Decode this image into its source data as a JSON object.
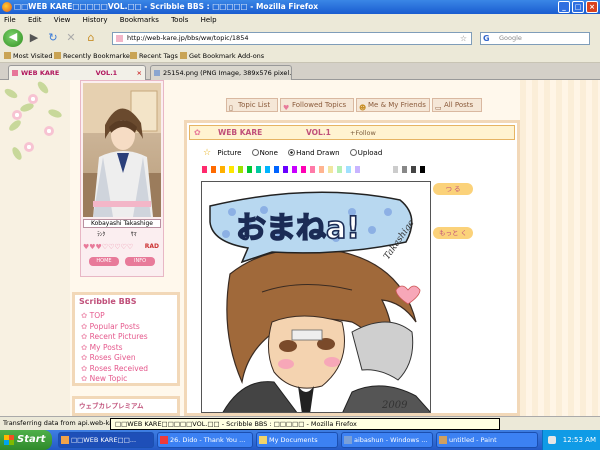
{
  "window": {
    "title": "□□WEB KARE□□□□□VOL.□□ - Scribble BBS : □□□□□ - Mozilla Firefox"
  },
  "menu": [
    "File",
    "Edit",
    "View",
    "History",
    "Bookmarks",
    "Tools",
    "Help"
  ],
  "nav": {
    "url": "http://web-kare.jp/bbs/ww/topic/1854",
    "search_placeholder": "Google"
  },
  "bookmarks": [
    "Most Visited",
    "Recently Bookmarked",
    "Recent Tags",
    "Get Bookmark Add-ons"
  ],
  "tabs": [
    {
      "label": "WEB KARE",
      "sub": "VOL.1"
    },
    {
      "label": "25154.png (PNG Image, 389x576 pixel..."
    }
  ],
  "profile": {
    "username": "Kobayashi Takashige",
    "rank_left": "ﾗﾝｸ",
    "rank_right": "ｻﾏ",
    "hearts": "♥♥♥♡♡♡♡♡",
    "rad": "RAD",
    "btn_left": "HOME",
    "btn_right": "INFO"
  },
  "sidebar": {
    "title": "Scribble BBS",
    "items": [
      "TOP",
      "Popular Posts",
      "Recent Pictures",
      "My Posts",
      "Roses Given",
      "Roses Received",
      "New Topic"
    ],
    "premium": "ウェブカレプレミアム"
  },
  "navtabs": [
    "Topic List",
    "Followed Topics",
    "Me & My Friends",
    "All Posts"
  ],
  "post": {
    "site": "WEB KARE",
    "vol": "VOL.1",
    "follow": "+Follow",
    "modes": [
      "Picture",
      "None",
      "Hand Drawn",
      "Upload"
    ],
    "selected_mode": "Hand Drawn",
    "btn_tsumu": "つ る",
    "btn_motto": "もっと く"
  },
  "drawing": {
    "bubble_text": "おまねa!",
    "signature": "Takashige",
    "year": "2009"
  },
  "palette": [
    "#ff2a6d",
    "#ff6a00",
    "#ffb000",
    "#ffe600",
    "#9be100",
    "#00c832",
    "#00c8a0",
    "#00b4ff",
    "#0064ff",
    "#6a00ff",
    "#c800ff",
    "#ff00b4",
    "#ff7aa8",
    "#ffb490",
    "#f0e6a0",
    "#b4f0b4",
    "#a0e0ff",
    "#c8b4ff",
    "#ffffff",
    "#cccccc",
    "#888888",
    "#444444",
    "#000000"
  ],
  "status": {
    "text": "Transferring data from api.web-kare.jp...",
    "tooltip": "□□WEB KARE□□□□□VOL.□□ - Scribble BBS : □□□□□ - Mozilla Firefox"
  },
  "taskbar": {
    "start": "Start",
    "tasks": [
      "□□WEB KARE□□...",
      "26. Dido - Thank You ...",
      "My Documents",
      "aibashun - Windows ...",
      "untitled - Paint"
    ],
    "clock": "12:53 AM"
  }
}
